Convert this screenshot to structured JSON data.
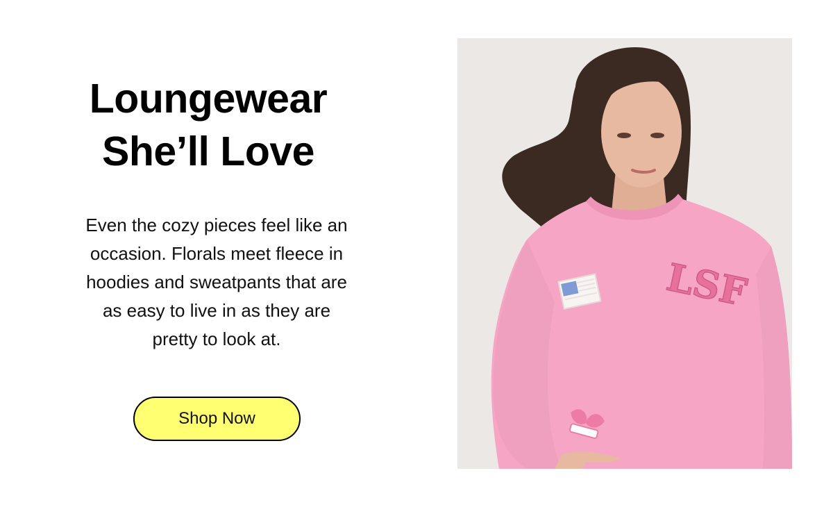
{
  "promo": {
    "headline_line1": "Loungewear",
    "headline_line2": "She’ll Love",
    "body_lines": [
      "Even the cozy pieces feel like an",
      "occasion. Florals meet fleece in",
      "hoodies and sweatpants that are",
      "as easy to live in as they are",
      "pretty to look at."
    ],
    "cta_label": "Shop Now",
    "colors": {
      "background": "#ffffff",
      "button_fill": "#ffff71",
      "button_border": "#000000",
      "text": "#000000"
    }
  },
  "photo": {
    "patch_monogram": "LSF",
    "colors": {
      "backdrop": "#ece8e6",
      "sweatshirt": "#f6a6c4",
      "hair": "#3a2a22",
      "skin": "#e6b9a0"
    }
  }
}
